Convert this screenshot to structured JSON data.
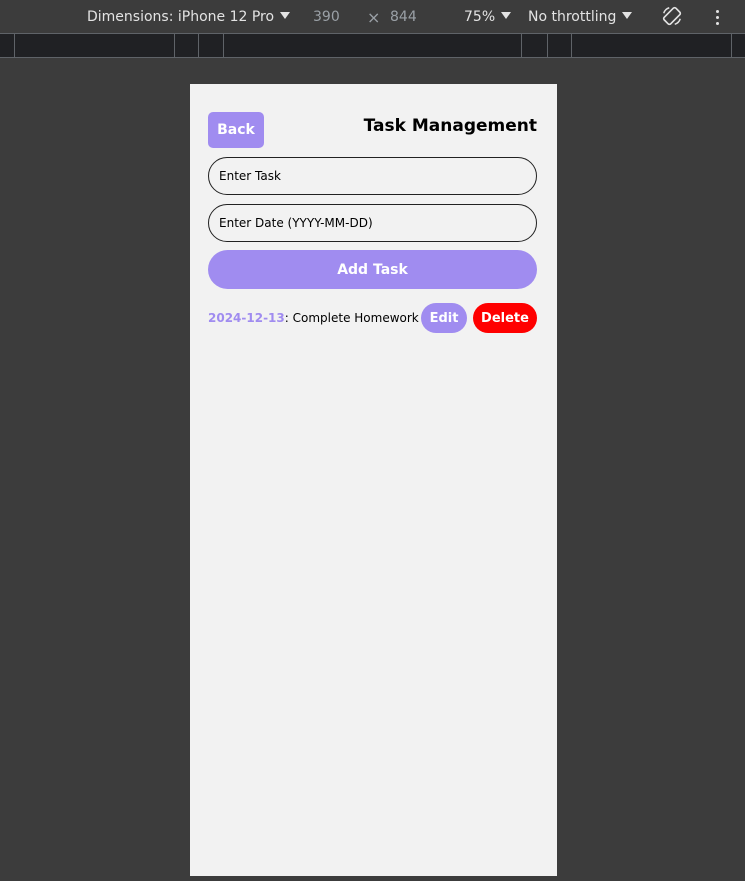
{
  "devtools": {
    "device_label": "Dimensions: iPhone 12 Pro",
    "width": "390",
    "times": "×",
    "height": "844",
    "zoom": "75%",
    "throttling": "No throttling",
    "icons": [
      "rotate-icon",
      "more-options-icon"
    ]
  },
  "app": {
    "back_label": "Back",
    "title": "Task Management",
    "task_input_placeholder": "Enter Task",
    "date_input_placeholder": "Enter Date (YYYY-MM-DD)",
    "add_label": "Add Task",
    "tasks": [
      {
        "date": "2024-12-13",
        "separator": ":",
        "name": " Complete Homework",
        "edit_label": "Edit",
        "delete_label": "Delete"
      }
    ]
  },
  "colors": {
    "accent": "#a08cf0",
    "danger": "#ff0000",
    "viewport_bg": "#f2f2f2",
    "chrome_bg": "#3c3c3c"
  }
}
